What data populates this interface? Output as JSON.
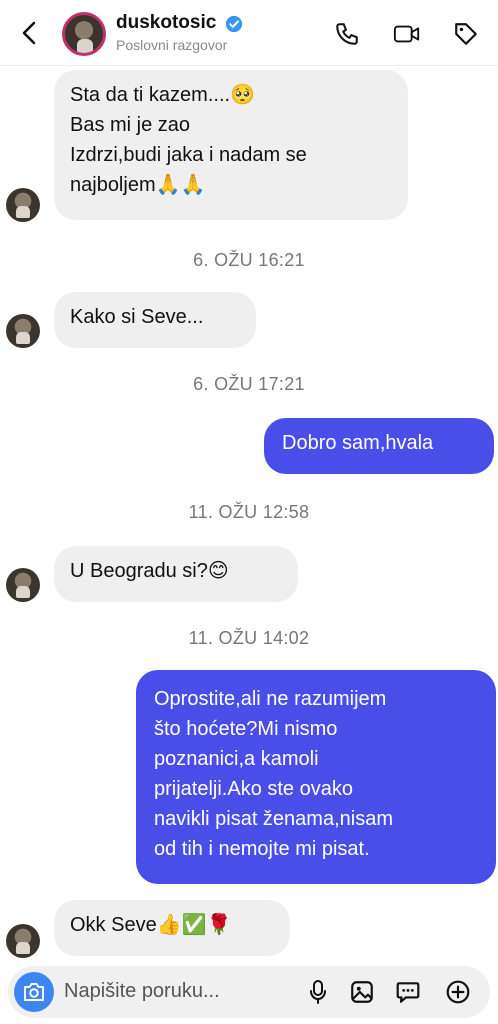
{
  "header": {
    "username": "duskotosic",
    "subtitle": "Poslovni razgovor"
  },
  "messages": [
    {
      "from": "them",
      "lines": [
        "Sta da ti kazem....🥺",
        "Bas mi je zao",
        "Izdrzi,budi jaka i nadam se",
        "najboljem🙏🙏"
      ]
    },
    {
      "stamp": "6. OŽU 16:21"
    },
    {
      "from": "them",
      "lines": [
        "Kako si Seve..."
      ]
    },
    {
      "stamp": "6. OŽU 17:21"
    },
    {
      "from": "me",
      "lines": [
        "Dobro sam,hvala"
      ]
    },
    {
      "stamp": "11. OŽU 12:58"
    },
    {
      "from": "them",
      "lines": [
        "U Beogradu si?😊"
      ]
    },
    {
      "stamp": "11. OŽU 14:02"
    },
    {
      "from": "me",
      "lines": [
        "Oprostite,ali ne razumijem",
        "što hoćete?Mi nismo",
        "poznanici,a kamoli",
        "prijatelji.Ako ste ovako",
        "navikli pisat ženama,nisam",
        "od tih i nemojte mi pisat."
      ]
    },
    {
      "from": "them",
      "lines": [
        "Okk Seve👍✅🌹"
      ]
    }
  ],
  "composer": {
    "placeholder": "Napišite poruku..."
  },
  "colors": {
    "outgoing_bubble": "#4a4ee8",
    "incoming_bubble": "#efefef",
    "camera_button": "#3d86f2",
    "verified_badge": "#3897f0"
  }
}
